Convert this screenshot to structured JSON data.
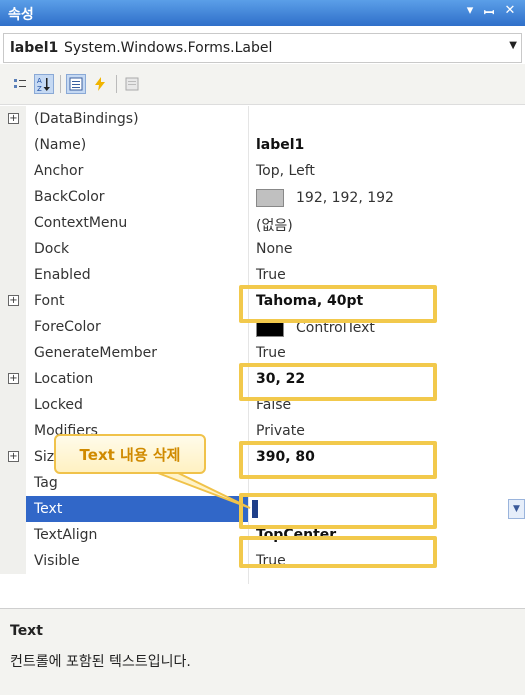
{
  "window": {
    "title": "속성"
  },
  "selector": {
    "name": "label1",
    "type": "System.Windows.Forms.Label"
  },
  "properties": [
    {
      "name": "(DataBindings)",
      "value": "",
      "expandable": true
    },
    {
      "name": "(Name)",
      "value": "label1",
      "bold": true
    },
    {
      "name": "Anchor",
      "value": "Top, Left"
    },
    {
      "name": "BackColor",
      "value": "192, 192, 192",
      "swatch": "#c0c0c0"
    },
    {
      "name": "ContextMenu",
      "value": "(없음)"
    },
    {
      "name": "Dock",
      "value": "None"
    },
    {
      "name": "Enabled",
      "value": "True"
    },
    {
      "name": "Font",
      "value": "Tahoma, 40pt",
      "bold": true,
      "expandable": true
    },
    {
      "name": "ForeColor",
      "value": "ControlText",
      "swatch": "#000000"
    },
    {
      "name": "GenerateMember",
      "value": "True"
    },
    {
      "name": "Location",
      "value": "30, 22",
      "bold": true,
      "expandable": true
    },
    {
      "name": "Locked",
      "value": "False"
    },
    {
      "name": "Modifiers",
      "value": "Private"
    },
    {
      "name": "Size",
      "value": "390, 80",
      "bold": true,
      "expandable": true
    },
    {
      "name": "Tag",
      "value": ""
    },
    {
      "name": "Text",
      "value": "",
      "selected": true
    },
    {
      "name": "TextAlign",
      "value": "TopCenter",
      "bold": true
    },
    {
      "name": "Visible",
      "value": "True"
    }
  ],
  "callout": {
    "text": "Text 내용 삭제"
  },
  "description": {
    "title": "Text",
    "text": "컨트롤에 포함된 텍스트입니다."
  },
  "colors": {
    "selection": "#3167c8",
    "highlight": "#f2c94c",
    "title_bar": "#2f6fc9"
  }
}
